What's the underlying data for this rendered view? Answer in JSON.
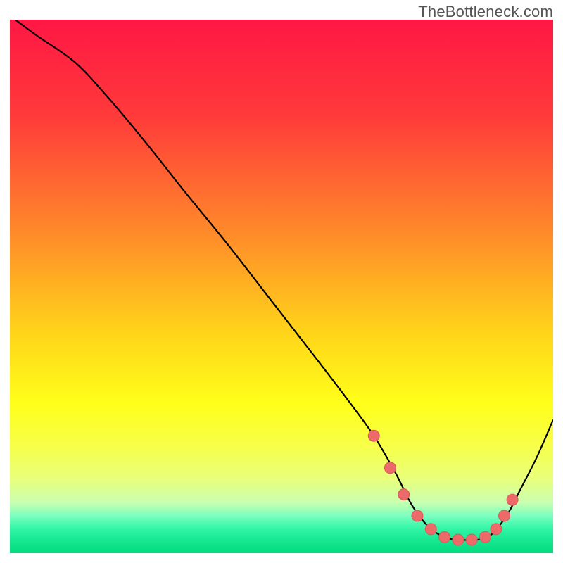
{
  "watermark": {
    "text": "TheBottleneck.com"
  },
  "colors": {
    "curve": "#000000",
    "dot_fill": "#ec6a6a",
    "dot_stroke": "#d85a5a",
    "gradient_stops": [
      {
        "offset": 0.0,
        "color": "#ff1744"
      },
      {
        "offset": 0.18,
        "color": "#ff3a3a"
      },
      {
        "offset": 0.4,
        "color": "#ff8a2a"
      },
      {
        "offset": 0.58,
        "color": "#ffd21a"
      },
      {
        "offset": 0.72,
        "color": "#ffff1a"
      },
      {
        "offset": 0.8,
        "color": "#f7ff4a"
      },
      {
        "offset": 0.86,
        "color": "#e8ff7a"
      },
      {
        "offset": 0.905,
        "color": "#caffb0"
      },
      {
        "offset": 0.93,
        "color": "#7affbf"
      },
      {
        "offset": 0.955,
        "color": "#30f5a5"
      },
      {
        "offset": 0.975,
        "color": "#18e892"
      },
      {
        "offset": 1.0,
        "color": "#00db7e"
      }
    ]
  },
  "chart_data": {
    "type": "line",
    "title": "",
    "xlabel": "",
    "ylabel": "",
    "xlim": [
      0,
      100
    ],
    "ylim": [
      0,
      100
    ],
    "grid": false,
    "legend": false,
    "notes": "Background is a vertical heat gradient (top=red ~worst, bottom=green ~best). A single black curve descends from the top-left, reaches a flat minimum near x≈75–88, then rises toward the right edge. Salmon dots mark the near-optimal basin of the curve.",
    "series": [
      {
        "name": "bottleneck-curve",
        "x": [
          1,
          5,
          12,
          18,
          25,
          32,
          40,
          48,
          56,
          62,
          67,
          71,
          74,
          77,
          80,
          83,
          86,
          88,
          90,
          92,
          94,
          97,
          100
        ],
        "y": [
          100,
          97,
          92,
          85.5,
          77,
          68,
          58,
          47.5,
          37,
          29,
          22,
          15,
          9,
          5,
          3,
          2.5,
          2.5,
          3,
          5,
          8,
          12,
          18,
          25
        ]
      }
    ],
    "dots": {
      "name": "optimal-points",
      "x": [
        67,
        70,
        72.5,
        75,
        77.5,
        80,
        82.5,
        85,
        87.5,
        89.5,
        91,
        92.5
      ],
      "y": [
        22,
        16,
        11,
        7,
        4.5,
        3,
        2.5,
        2.5,
        3,
        4.5,
        7,
        10
      ],
      "radius": 8
    }
  }
}
